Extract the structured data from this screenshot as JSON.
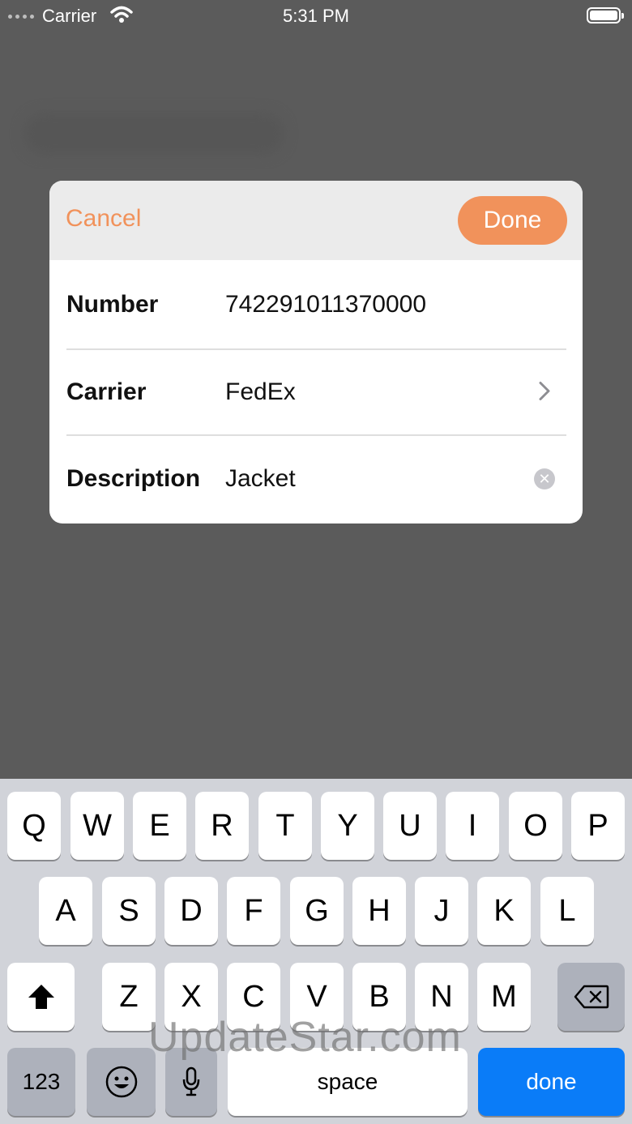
{
  "status_bar": {
    "carrier": "Carrier",
    "time": "5:31 PM"
  },
  "dialog": {
    "cancel_label": "Cancel",
    "done_label": "Done",
    "fields": {
      "number": {
        "label": "Number",
        "value": "742291011370000"
      },
      "carrier": {
        "label": "Carrier",
        "value": "FedEx"
      },
      "description": {
        "label": "Description",
        "value": "Jacket"
      }
    }
  },
  "keyboard": {
    "row1": [
      "Q",
      "W",
      "E",
      "R",
      "T",
      "Y",
      "U",
      "I",
      "O",
      "P"
    ],
    "row2": [
      "A",
      "S",
      "D",
      "F",
      "G",
      "H",
      "J",
      "K",
      "L"
    ],
    "row3": [
      "Z",
      "X",
      "C",
      "V",
      "B",
      "N",
      "M"
    ],
    "numbers_label": "123",
    "space_label": "space",
    "done_label": "done"
  },
  "watermark": "UpdateStar.com",
  "colors": {
    "accent": "#f1925b",
    "keyboard_done": "#0a7cf8"
  }
}
